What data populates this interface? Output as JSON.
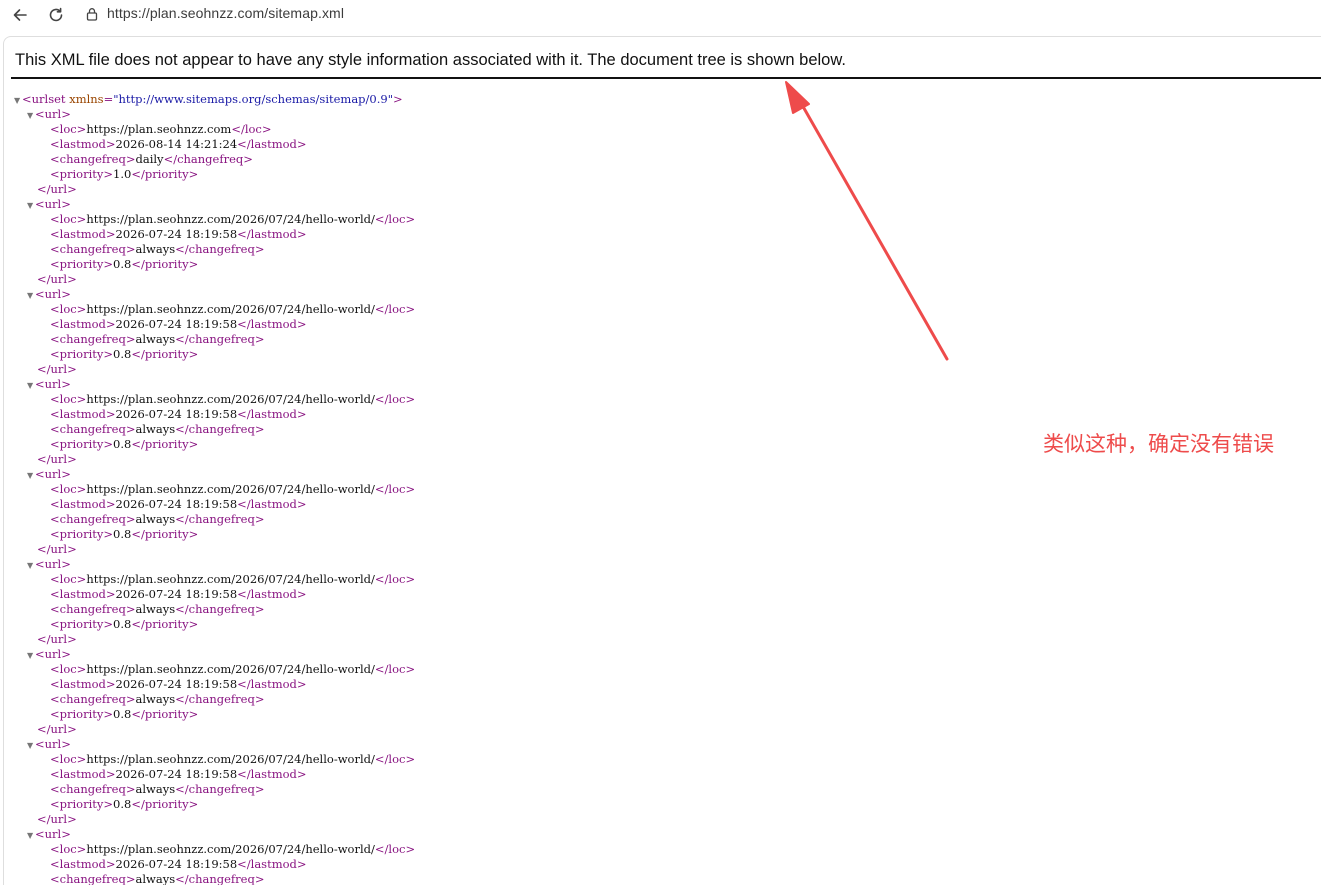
{
  "browser": {
    "url": "https://plan.seohnzz.com/sitemap.xml",
    "back_icon": "back-arrow-icon",
    "reload_icon": "reload-icon",
    "lock_icon": "site-info-icon"
  },
  "page": {
    "info_message": "This XML file does not appear to have any style information associated with it. The document tree is shown below.",
    "root_open_prefix": "<urlset",
    "root_attr_name": "xmlns",
    "root_attr_value": "\"http://www.sitemaps.org/schemas/sitemap/0.9\"",
    "root_open_suffix": ">",
    "tags": {
      "url_open": "<url>",
      "url_close": "</url>",
      "loc_open": "<loc>",
      "loc_close": "</loc>",
      "lastmod_open": "<lastmod>",
      "lastmod_close": "</lastmod>",
      "changefreq_open": "<changefreq>",
      "changefreq_close": "</changefreq>",
      "priority_open": "<priority>",
      "priority_close": "</priority>"
    },
    "urls": [
      {
        "loc": "https://plan.seohnzz.com",
        "lastmod": "2026-08-14 14:21:24",
        "changefreq": "daily",
        "priority": "1.0"
      },
      {
        "loc": "https://plan.seohnzz.com/2026/07/24/hello-world/",
        "lastmod": "2026-07-24 18:19:58",
        "changefreq": "always",
        "priority": "0.8"
      },
      {
        "loc": "https://plan.seohnzz.com/2026/07/24/hello-world/",
        "lastmod": "2026-07-24 18:19:58",
        "changefreq": "always",
        "priority": "0.8"
      },
      {
        "loc": "https://plan.seohnzz.com/2026/07/24/hello-world/",
        "lastmod": "2026-07-24 18:19:58",
        "changefreq": "always",
        "priority": "0.8"
      },
      {
        "loc": "https://plan.seohnzz.com/2026/07/24/hello-world/",
        "lastmod": "2026-07-24 18:19:58",
        "changefreq": "always",
        "priority": "0.8"
      },
      {
        "loc": "https://plan.seohnzz.com/2026/07/24/hello-world/",
        "lastmod": "2026-07-24 18:19:58",
        "changefreq": "always",
        "priority": "0.8"
      },
      {
        "loc": "https://plan.seohnzz.com/2026/07/24/hello-world/",
        "lastmod": "2026-07-24 18:19:58",
        "changefreq": "always",
        "priority": "0.8"
      },
      {
        "loc": "https://plan.seohnzz.com/2026/07/24/hello-world/",
        "lastmod": "2026-07-24 18:19:58",
        "changefreq": "always",
        "priority": "0.8"
      },
      {
        "loc": "https://plan.seohnzz.com/2026/07/24/hello-world/",
        "lastmod": "2026-07-24 18:19:58",
        "changefreq": "always",
        "priority": null
      }
    ]
  },
  "annotation": {
    "note": "类似这种，确定没有错误",
    "color": "#ee4b4b"
  },
  "colors": {
    "tag": "#881280",
    "attr_name": "#994500",
    "attr_value": "#1a1aa6"
  }
}
